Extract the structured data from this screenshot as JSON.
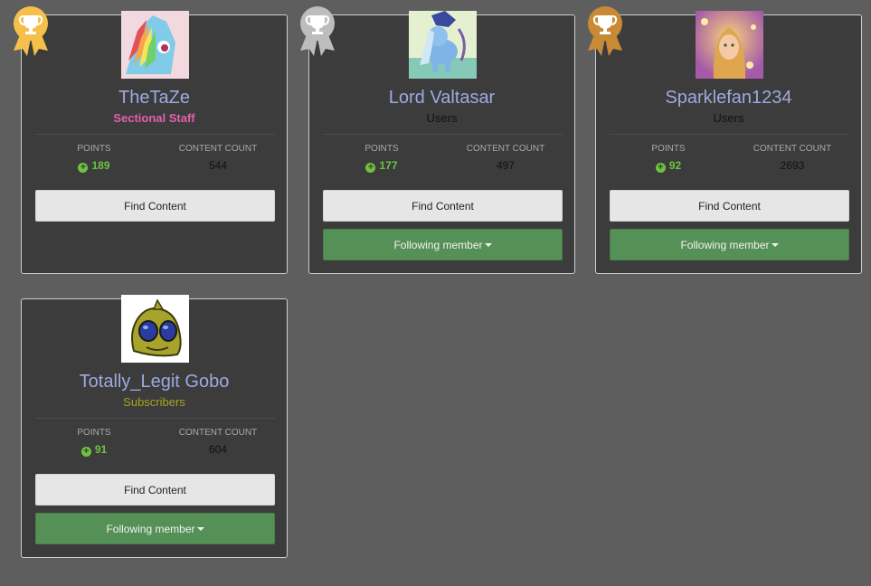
{
  "colors": {
    "gold": "#f5c04a",
    "silver": "#bdbdbd",
    "bronze": "#c98a36",
    "name": "#9fa9df",
    "points": "#6ec43c",
    "follow_button": "#559056"
  },
  "labels": {
    "points": "Points",
    "content_count": "Content Count",
    "find_content": "Find Content",
    "following_member": "Following member"
  },
  "members": [
    {
      "rank": "gold",
      "name": "TheTaZe",
      "group": "Sectional Staff",
      "group_color": "#e35fae",
      "points": "189",
      "content_count": "544",
      "following": false
    },
    {
      "rank": "silver",
      "name": "Lord Valtasar",
      "group": "Users",
      "group_color": "#111111",
      "points": "177",
      "content_count": "497",
      "following": true
    },
    {
      "rank": "bronze",
      "name": "Sparklefan1234",
      "group": "Users",
      "group_color": "#111111",
      "points": "92",
      "content_count": "2693",
      "following": true
    },
    {
      "rank": "",
      "name": "Totally_Legit Gobo",
      "group": "Subscribers",
      "group_color": "#a4a61e",
      "points": "91",
      "content_count": "604",
      "following": true
    }
  ]
}
